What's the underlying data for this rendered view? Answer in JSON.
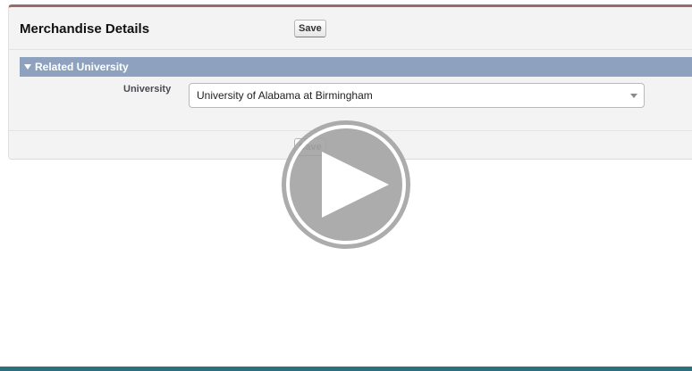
{
  "page": {
    "title": "Merchandise Details",
    "save_label": "Save"
  },
  "section": {
    "title": "Related University",
    "university_label": "University",
    "university_value": "University of Alabama at Birmingham"
  },
  "overlay": {
    "icon": "play-icon"
  },
  "colors": {
    "header_accent": "#9a6a6b",
    "section_bar": "#8ea2bf",
    "bottom_stripe": "#2c6f7d"
  }
}
